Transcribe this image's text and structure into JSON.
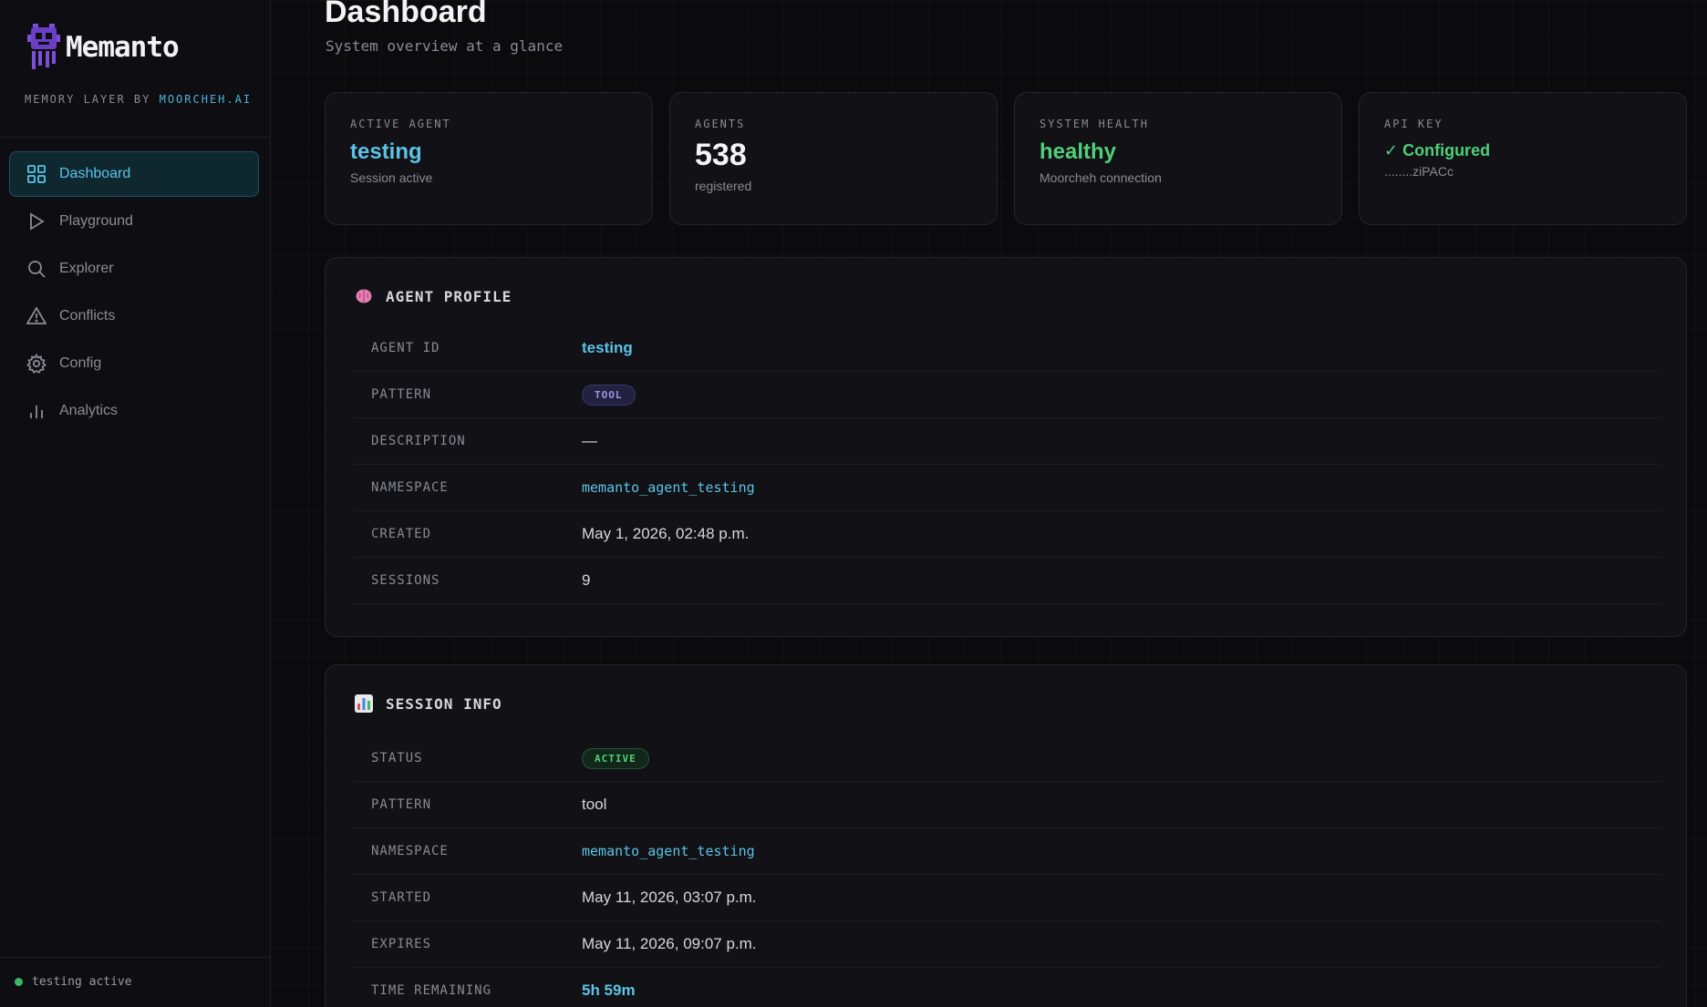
{
  "brand": {
    "name": "Memanto",
    "subtitle_prefix": "MEMORY LAYER BY ",
    "subtitle_accent": "MOORCHEH.AI"
  },
  "sidebar": {
    "items": [
      {
        "label": "Dashboard",
        "icon": "grid-icon",
        "active": true
      },
      {
        "label": "Playground",
        "icon": "play-icon",
        "active": false
      },
      {
        "label": "Explorer",
        "icon": "search-icon",
        "active": false
      },
      {
        "label": "Conflicts",
        "icon": "warning-icon",
        "active": false
      },
      {
        "label": "Config",
        "icon": "gear-icon",
        "active": false
      },
      {
        "label": "Analytics",
        "icon": "bar-chart-icon",
        "active": false
      }
    ],
    "footer_status": "testing active"
  },
  "header": {
    "title": "Dashboard",
    "subtitle": "System overview at a glance"
  },
  "stats": [
    {
      "label": "ACTIVE AGENT",
      "value": "testing",
      "sub": "Session active",
      "color": "#5cc3e6"
    },
    {
      "label": "AGENTS",
      "value": "538",
      "sub": "registered",
      "color": "#f4f4f7"
    },
    {
      "label": "SYSTEM HEALTH",
      "value": "healthy",
      "sub": "Moorcheh connection",
      "color": "#4fcf78"
    },
    {
      "label": "API KEY",
      "value": "✓ Configured",
      "sub": "........ziPACc",
      "color": "#4fcf78"
    }
  ],
  "agent_profile": {
    "title": "AGENT PROFILE",
    "icon": "brain-icon",
    "rows": [
      {
        "key": "AGENT ID",
        "value": "testing"
      },
      {
        "key": "PATTERN",
        "value": "TOOL"
      },
      {
        "key": "DESCRIPTION",
        "value": "—"
      },
      {
        "key": "NAMESPACE",
        "value": "memanto_agent_testing"
      },
      {
        "key": "CREATED",
        "value": "May 1, 2026, 02:48 p.m."
      },
      {
        "key": "SESSIONS",
        "value": "9"
      }
    ]
  },
  "session_info": {
    "title": "SESSION INFO",
    "icon": "bar-chart-icon",
    "rows": [
      {
        "key": "STATUS",
        "value": "ACTIVE"
      },
      {
        "key": "PATTERN",
        "value": "tool"
      },
      {
        "key": "NAMESPACE",
        "value": "memanto_agent_testing"
      },
      {
        "key": "STARTED",
        "value": "May 11, 2026, 03:07 p.m."
      },
      {
        "key": "EXPIRES",
        "value": "May 11, 2026, 09:07 p.m."
      },
      {
        "key": "TIME REMAINING",
        "value": "5h 59m"
      }
    ]
  },
  "colors": {
    "accent": "#5cc3e6",
    "healthy": "#4fcf78",
    "logo": "#7b4fd6"
  }
}
